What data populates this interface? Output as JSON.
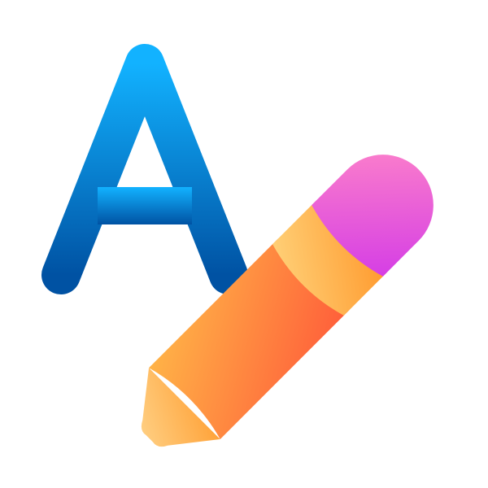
{
  "icon": {
    "name": "text-edit-icon",
    "parts": [
      "letter-a",
      "pencil"
    ]
  },
  "colors": {
    "letter_top": "#12B2FF",
    "letter_bottom": "#0052A3",
    "pencil_body_light": "#FFB347",
    "pencil_body_dark": "#FF5E3A",
    "ferrule_light": "#FFD27A",
    "ferrule_dark": "#FF9A2E",
    "eraser_light": "#FF85C8",
    "eraser_dark": "#D43CE6",
    "tip_light": "#FFD891",
    "tip_dark": "#FFA33A",
    "background": "#FFFFFF"
  }
}
